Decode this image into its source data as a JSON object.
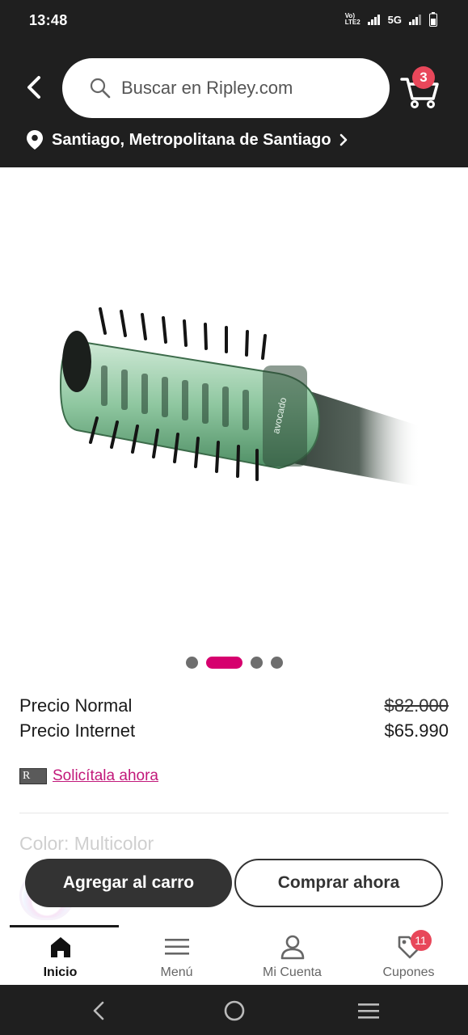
{
  "status_bar": {
    "time": "13:48",
    "network_type": "5G",
    "volte_label": "VoLTE2"
  },
  "header": {
    "search_placeholder": "Buscar en Ripley.com",
    "cart_count": "3",
    "location": "Santiago, Metropolitana de Santiago"
  },
  "product": {
    "image_icon": "hair-brush-dryer-image",
    "carousel": {
      "total": 4,
      "active_index": 1
    },
    "brand_text_on_product": "avocado",
    "price_normal_label": "Precio Normal",
    "price_normal_value": "$82.000",
    "price_internet_label": "Precio Internet",
    "price_internet_value": "$65.990",
    "card_logo_text": "R",
    "card_link": "Solicítala ahora",
    "color_label": "Color: Multicolor"
  },
  "actions": {
    "add_to_cart": "Agregar al carro",
    "buy_now": "Comprar ahora"
  },
  "bottom_nav": {
    "items": [
      {
        "label": "Inicio",
        "icon": "home-icon",
        "active": true
      },
      {
        "label": "Menú",
        "icon": "menu-icon",
        "active": false
      },
      {
        "label": "Mi Cuenta",
        "icon": "user-icon",
        "active": false
      },
      {
        "label": "Cupones",
        "icon": "coupon-tag-icon",
        "active": false
      }
    ],
    "coupon_count": "11"
  },
  "colors": {
    "accent": "#d6006e",
    "badge": "#e8475a",
    "header_bg": "#1f1f1f"
  }
}
